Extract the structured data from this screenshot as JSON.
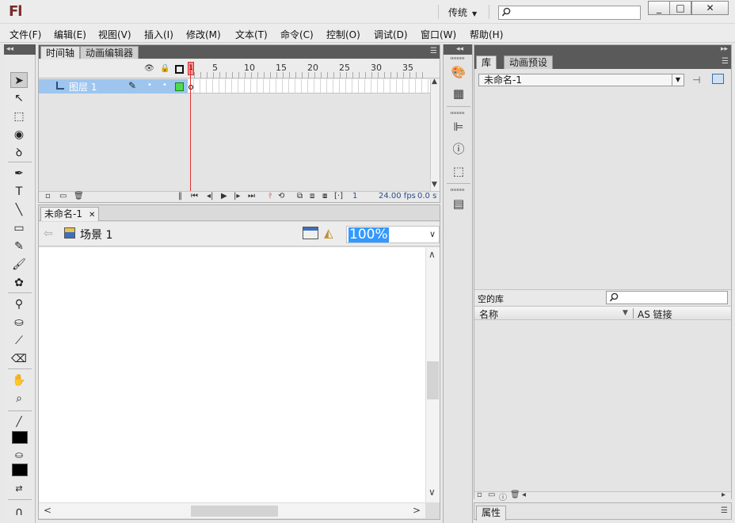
{
  "app": {
    "logo": "Fl",
    "workspace": "传统",
    "help_search_placeholder": ""
  },
  "window_controls": {
    "minimize": "_",
    "maximize": "□",
    "close": "✕"
  },
  "menu": [
    "文件(F)",
    "编辑(E)",
    "视图(V)",
    "插入(I)",
    "修改(M)",
    "文本(T)",
    "命令(C)",
    "控制(O)",
    "调试(D)",
    "窗口(W)",
    "帮助(H)"
  ],
  "tools": [
    {
      "name": "selection-tool",
      "glyph": "➤"
    },
    {
      "name": "subselection-tool",
      "glyph": "↖"
    },
    {
      "name": "free-transform-tool",
      "glyph": "⬚"
    },
    {
      "name": "3d-rotation-tool",
      "glyph": "◉"
    },
    {
      "name": "lasso-tool",
      "glyph": "ꝺ"
    },
    {
      "name": "pen-tool",
      "glyph": "✒"
    },
    {
      "name": "text-tool",
      "glyph": "T"
    },
    {
      "name": "line-tool",
      "glyph": "╲"
    },
    {
      "name": "rectangle-tool",
      "glyph": "▭"
    },
    {
      "name": "pencil-tool",
      "glyph": "✎"
    },
    {
      "name": "brush-tool",
      "glyph": "🖌"
    },
    {
      "name": "deco-tool",
      "glyph": "✿"
    },
    {
      "name": "bone-tool",
      "glyph": "⚲"
    },
    {
      "name": "paint-bucket-tool",
      "glyph": "⛀"
    },
    {
      "name": "eyedropper-tool",
      "glyph": "⟋"
    },
    {
      "name": "eraser-tool",
      "glyph": "⌫"
    },
    {
      "name": "hand-tool",
      "glyph": "✋"
    },
    {
      "name": "zoom-tool",
      "glyph": "⌕"
    }
  ],
  "timeline": {
    "tabs": [
      "时间轴",
      "动画编辑器"
    ],
    "frame_numbers": [
      "1",
      "5",
      "10",
      "15",
      "20",
      "25",
      "30",
      "35"
    ],
    "layer_name": "图层 1",
    "fps": "24.00 fps",
    "current_frame": "1",
    "elapsed": "0.0 s"
  },
  "document": {
    "tab": "未命名-1",
    "scene": "场景 1",
    "zoom": "100%"
  },
  "library": {
    "tabs": [
      "库",
      "动画预设"
    ],
    "document_select": "未命名-1",
    "item_count": "空的库",
    "search_placeholder": "",
    "col_name": "名称",
    "col_linkage": "AS 链接"
  },
  "properties": {
    "tab": "属性"
  },
  "colors": {
    "layer_highlight": "#9ec5ee",
    "playhead": "#dd3333",
    "zoom_highlight": "#3399ff"
  }
}
